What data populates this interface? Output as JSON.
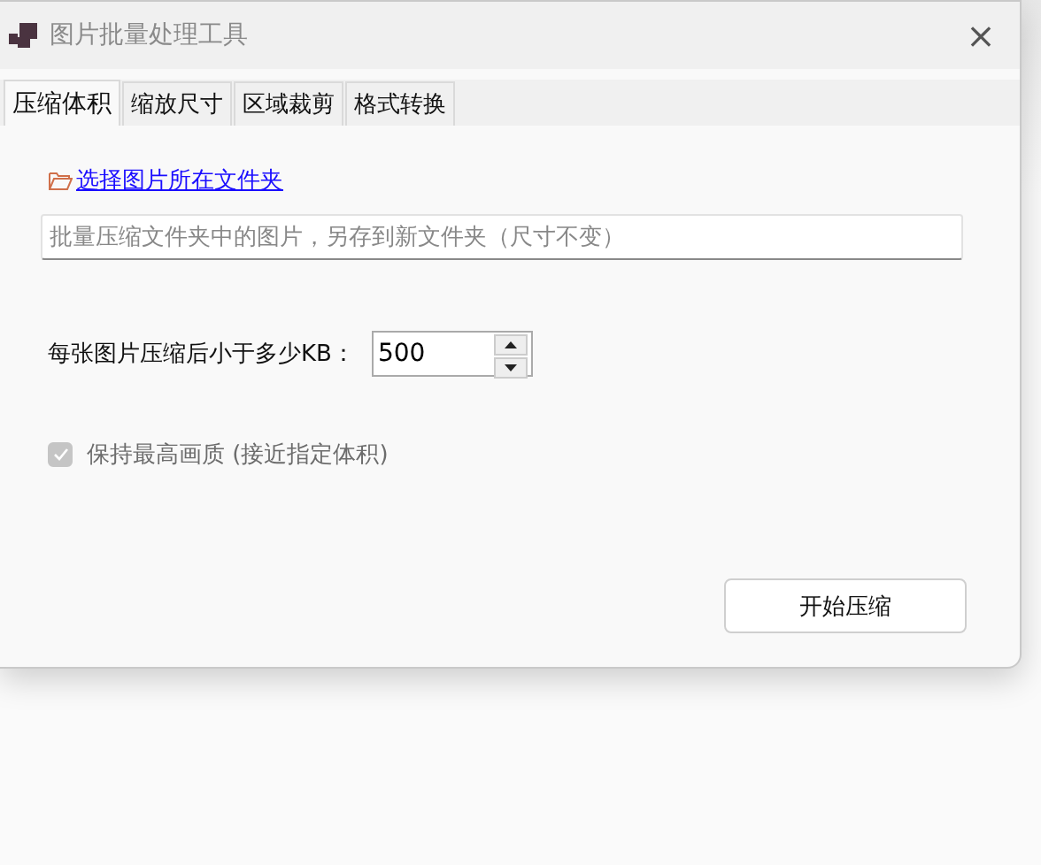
{
  "window": {
    "title": "图片批量处理工具",
    "close": "×"
  },
  "tabs": [
    {
      "label": "压缩体积",
      "selected": true
    },
    {
      "label": "缩放尺寸",
      "selected": false
    },
    {
      "label": "区域裁剪",
      "selected": false
    },
    {
      "label": "格式转换",
      "selected": false
    }
  ],
  "folder_link": "选择图片所在文件夹",
  "path_field": {
    "placeholder": "批量压缩文件夹中的图片，另存到新文件夹（尺寸不变）"
  },
  "size_limit": {
    "label": "每张图片压缩后小于多少KB：",
    "value": "500"
  },
  "keep_quality": {
    "label": "保持最高画质 (接近指定体积)",
    "checked": true,
    "disabled": true
  },
  "start_button": "开始压缩"
}
